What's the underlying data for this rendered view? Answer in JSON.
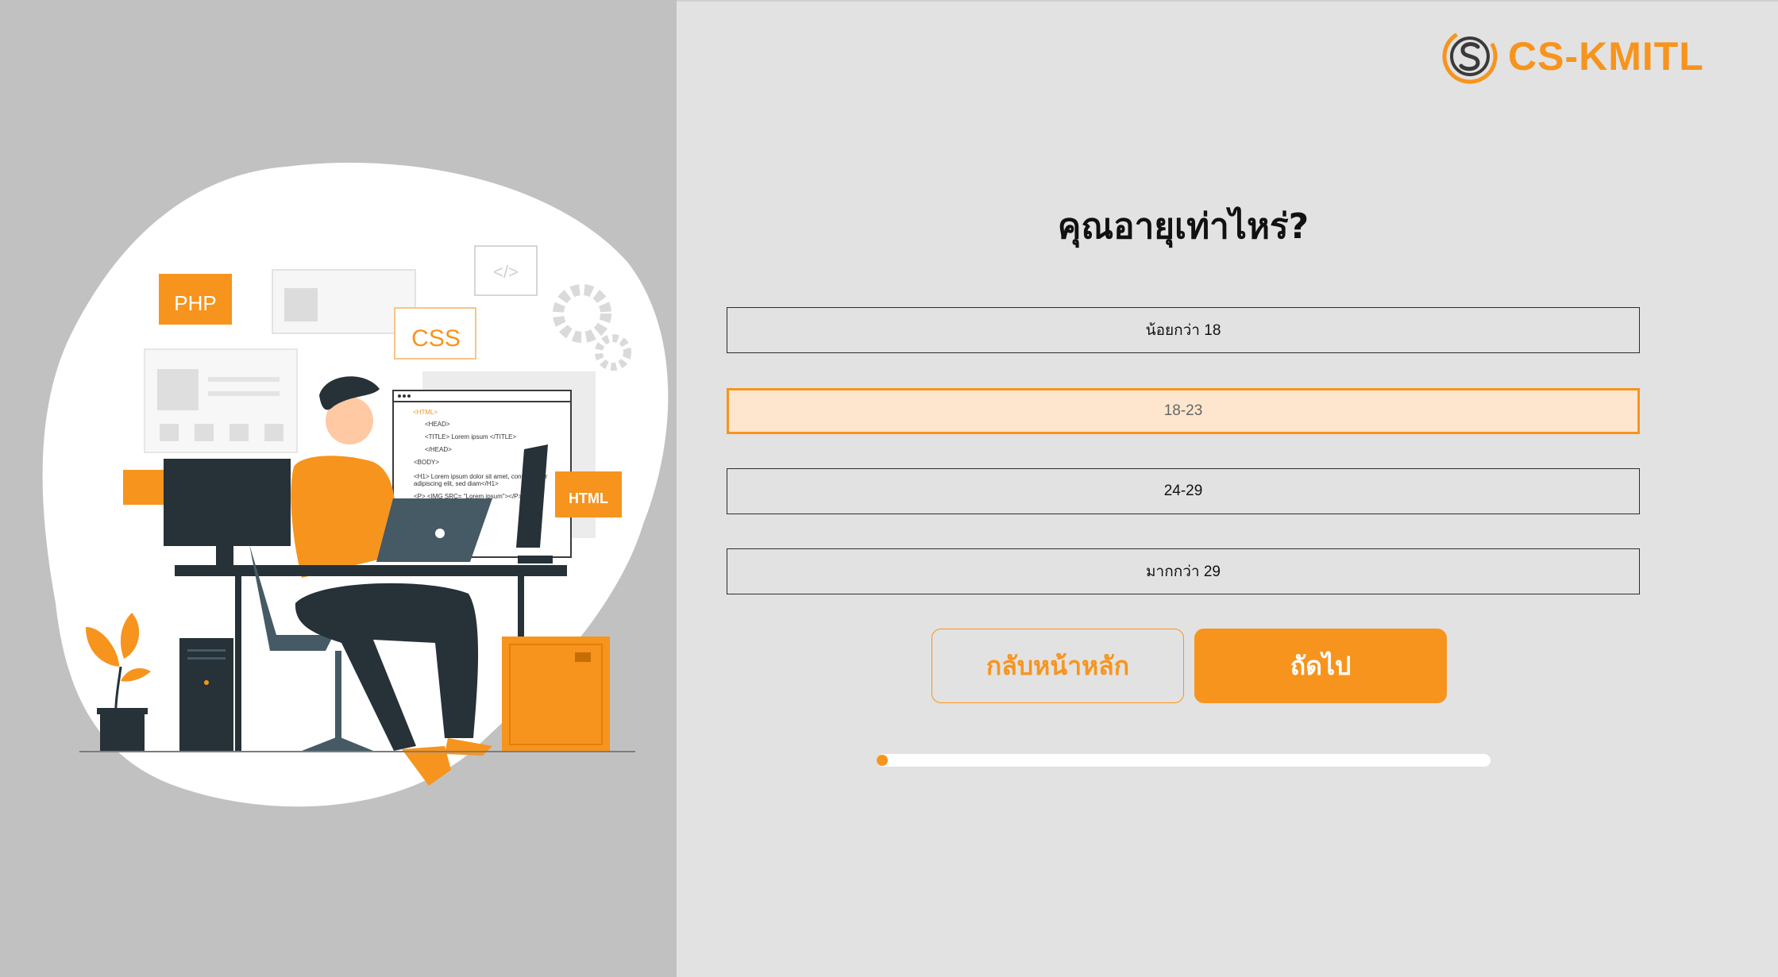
{
  "brand": {
    "logo_text": "CS-KMITL",
    "accent_color": "#f7941d"
  },
  "illustration": {
    "labels": {
      "php": "PHP",
      "css": "CSS",
      "html": "HTML",
      "code_tag": "</>"
    },
    "code_lines": [
      "<HTML>",
      "<HEAD>",
      "<TITLE> Lorem ipsum </TITLE>",
      "</HEAD>",
      "<BODY>",
      "<H1> Lorem ipsum dolor sit amet, consectetuer",
      "adipiscing elit, sed diam</H1>",
      "<P> <IMG SRC= \"Lorem ipsum\"></P>"
    ]
  },
  "quiz": {
    "question": "คุณอายุเท่าไหร่?",
    "options": [
      {
        "label": "น้อยกว่า 18",
        "selected": false
      },
      {
        "label": "18-23",
        "selected": true
      },
      {
        "label": "24-29",
        "selected": false
      },
      {
        "label": "มากกว่า 29",
        "selected": false
      }
    ],
    "back_label": "กลับหน้าหลัก",
    "next_label": "ถัดไป",
    "progress": 0.0
  }
}
